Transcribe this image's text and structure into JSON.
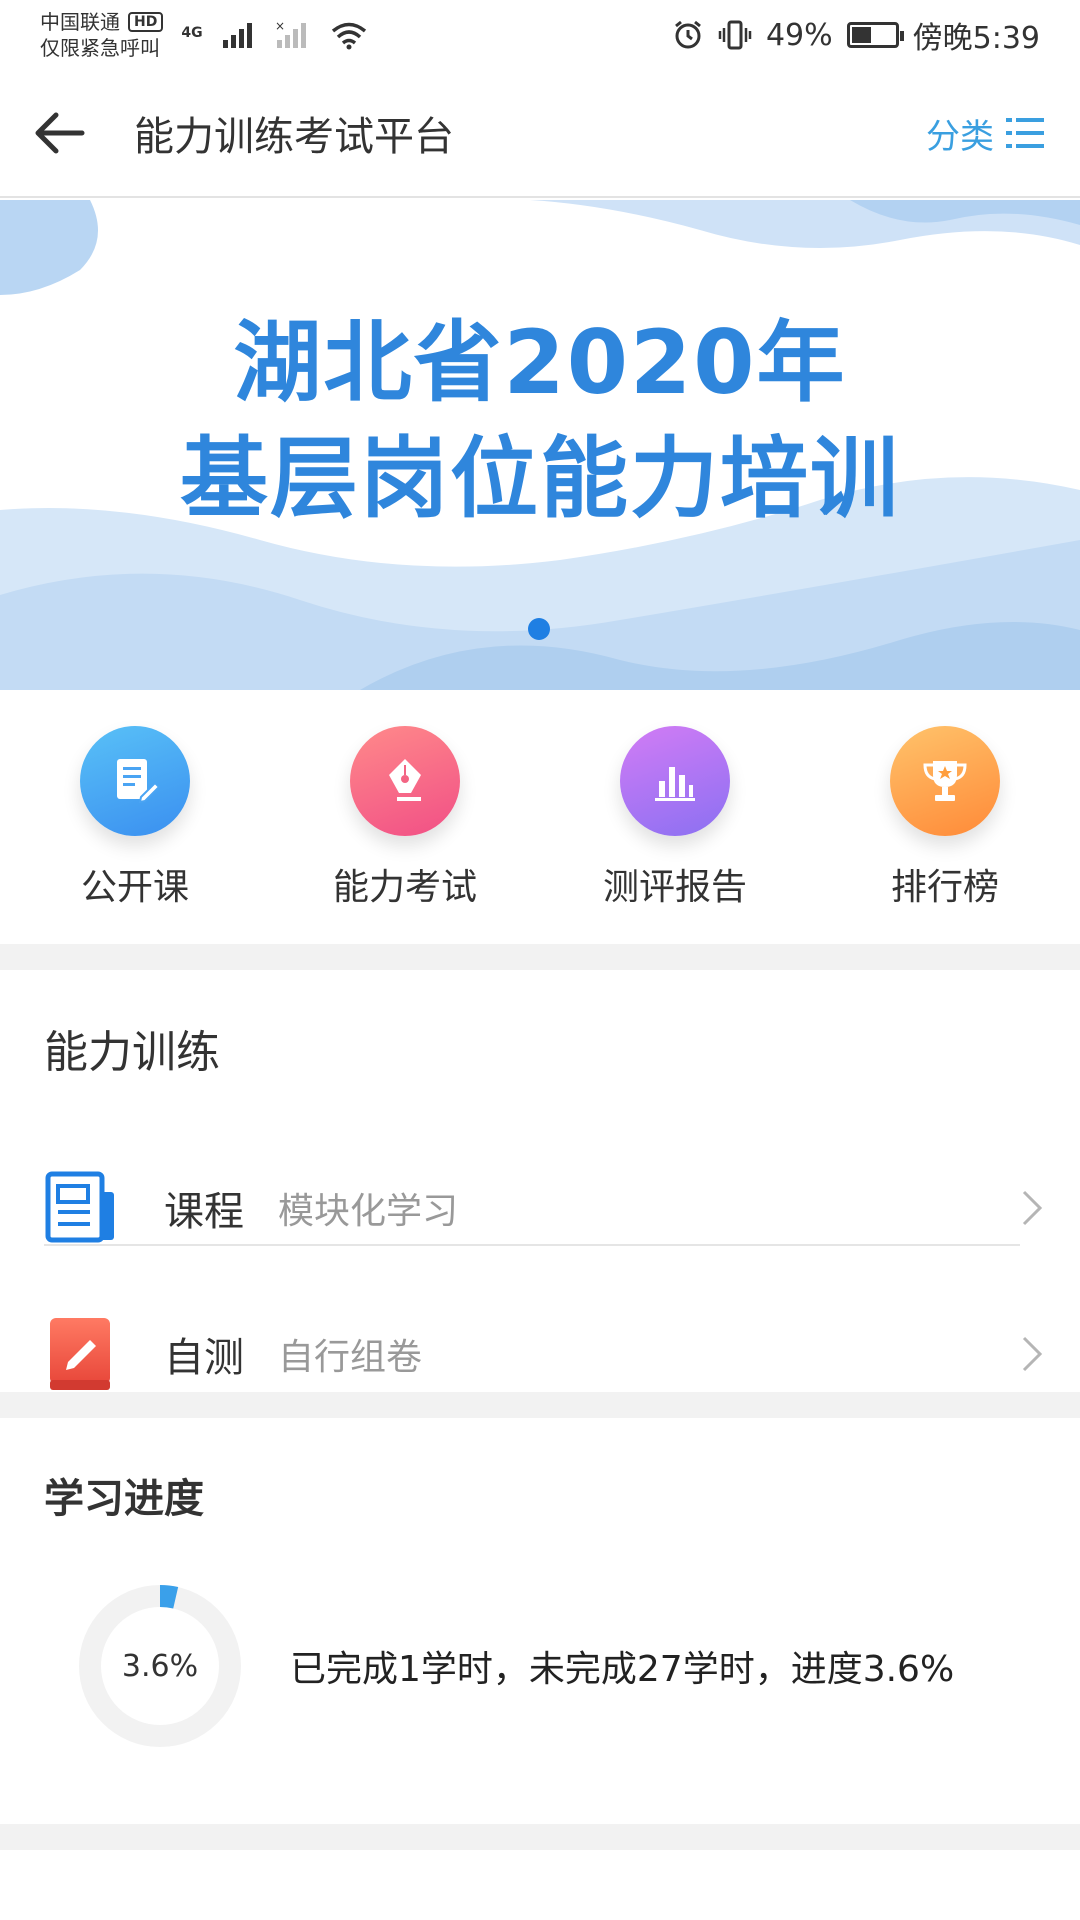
{
  "status_bar": {
    "carrier_line1": "中国联通",
    "hd_badge": "HD",
    "carrier_line2": "仅限紧急呼叫",
    "network": "4G",
    "battery_percent": "49%",
    "time": "傍晚5:39",
    "battery_level": 0.49
  },
  "header": {
    "title": "能力训练考试平台",
    "category_label": "分类"
  },
  "banner": {
    "line1": "湖北省2020年",
    "line2": "基层岗位能力培训",
    "active_slide": 1
  },
  "quick_actions": [
    {
      "label": "公开课",
      "icon": "document-edit-icon",
      "color_from": "#59c1f7",
      "color_to": "#3a8ff0"
    },
    {
      "label": "能力考试",
      "icon": "pen-nib-icon",
      "color_from": "#ff8a8a",
      "color_to": "#f14f86"
    },
    {
      "label": "测评报告",
      "icon": "bar-chart-icon",
      "color_from": "#d27cf5",
      "color_to": "#8b70f2"
    },
    {
      "label": "排行榜",
      "icon": "trophy-icon",
      "color_from": "#ffc36b",
      "color_to": "#ff8a38"
    }
  ],
  "training": {
    "section_title": "能力训练",
    "items": [
      {
        "title": "课程",
        "subtitle": "模块化学习",
        "icon": "newspaper-icon"
      },
      {
        "title": "自测",
        "subtitle": "自行组卷",
        "icon": "pencil-tablet-icon"
      }
    ]
  },
  "progress": {
    "section_title": "学习进度",
    "percent_label": "3.6%",
    "percent_value": 0.036,
    "summary": "已完成1学时，未完成27学时，进度3.6%"
  },
  "colors": {
    "accent": "#3a9fe0",
    "banner_text": "#2f86dc",
    "ring_track": "#f2f2f2",
    "ring_fill": "#3aa0ea"
  }
}
